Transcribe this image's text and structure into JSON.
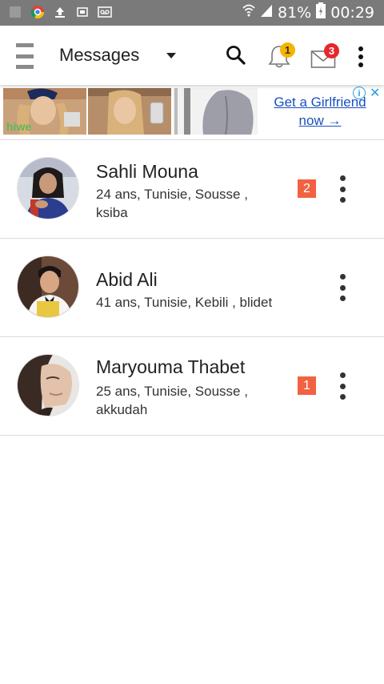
{
  "status_bar": {
    "battery": "81%",
    "time": "00:29"
  },
  "toolbar": {
    "title": "Messages",
    "notifications_count": "1",
    "messages_count": "3"
  },
  "ad": {
    "brand": "hiwe",
    "cta_line1": "Get a Girlfriend",
    "cta_line2": "now →"
  },
  "conversations": [
    {
      "name": "Sahli Mouna",
      "details": "24 ans, Tunisie, Sousse , ksiba",
      "unread": "2"
    },
    {
      "name": "Abid Ali",
      "details": "41 ans, Tunisie, Kebili , blidet",
      "unread": ""
    },
    {
      "name": "Maryouma Thabet",
      "details": "25 ans, Tunisie, Sousse , akkudah",
      "unread": "1"
    }
  ],
  "colors": {
    "status_bar": "#7a7a7a",
    "unread_badge": "#f26241",
    "notif_badge": "#f5b400",
    "msg_badge": "#e8262d",
    "ad_link": "#1a4fbf"
  }
}
